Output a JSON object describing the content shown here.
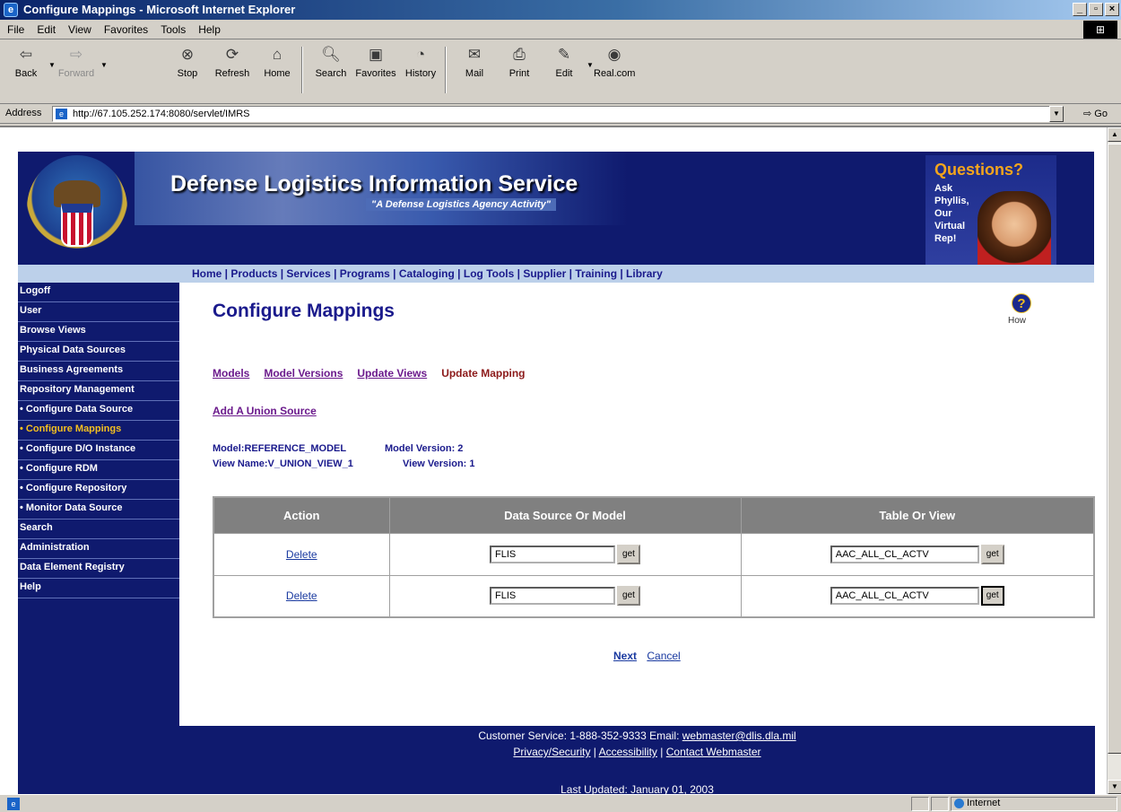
{
  "window": {
    "title": "Configure Mappings - Microsoft Internet Explorer"
  },
  "menu": [
    "File",
    "Edit",
    "View",
    "Favorites",
    "Tools",
    "Help"
  ],
  "toolbar": {
    "back": "Back",
    "forward": "Forward",
    "stop": "Stop",
    "refresh": "Refresh",
    "home": "Home",
    "search": "Search",
    "favorites": "Favorites",
    "history": "History",
    "mail": "Mail",
    "print": "Print",
    "edit": "Edit",
    "real": "Real.com"
  },
  "address": {
    "label": "Address",
    "url": "http://67.105.252.174:8080/servlet/IMRS",
    "go": "Go"
  },
  "banner": {
    "title": "Defense Logistics Information Service",
    "subtitle": "\"A Defense Logistics Agency Activity\"",
    "questions_title": "Questions?",
    "questions_lines": [
      "Ask",
      "Phyllis,",
      "Our",
      "Virtual",
      "Rep!"
    ]
  },
  "nav": "Home | Products | Services | Programs | Cataloging | Log Tools | Supplier | Training | Library",
  "sidebar": {
    "items": [
      "Logoff",
      "User",
      "Browse Views",
      "Physical Data Sources",
      "Business Agreements",
      "Repository Management",
      "• Configure Data Source",
      "• Configure Mappings",
      "• Configure D/O Instance",
      "• Configure RDM",
      "• Configure Repository",
      "• Monitor Data Source",
      "Search",
      "Administration",
      "Data Element Registry",
      "Help"
    ]
  },
  "main": {
    "title": "Configure Mappings",
    "help_label": "How",
    "tabs": [
      "Models",
      "Model Versions",
      "Update Views",
      "Update Mapping"
    ],
    "add_union": "Add A Union Source",
    "model_label": "Model:REFERENCE_MODEL",
    "model_version_label": "Model Version: 2",
    "view_name_label": "View Name:V_UNION_VIEW_1",
    "view_version_label": "View Version: 1",
    "table": {
      "headers": [
        "Action",
        "Data Source Or Model",
        "Table Or View"
      ],
      "rows": [
        {
          "action": "Delete",
          "source": "FLIS",
          "get": "get",
          "table": "AAC_ALL_CL_ACTV",
          "get2": "get"
        },
        {
          "action": "Delete",
          "source": "FLIS",
          "get": "get",
          "table": "AAC_ALL_CL_ACTV",
          "get2": "get"
        }
      ]
    },
    "next": "Next",
    "cancel": "Cancel"
  },
  "footer": {
    "customer_service": "Customer Service: 1-888-352-9333 Email: ",
    "email": "webmaster@dlis.dla.mil",
    "privacy": "Privacy/Security",
    "accessibility": "Accessibility",
    "contact": "Contact Webmaster",
    "updated": "Last Updated: January 01, 2003"
  },
  "status": {
    "zone": "Internet"
  }
}
